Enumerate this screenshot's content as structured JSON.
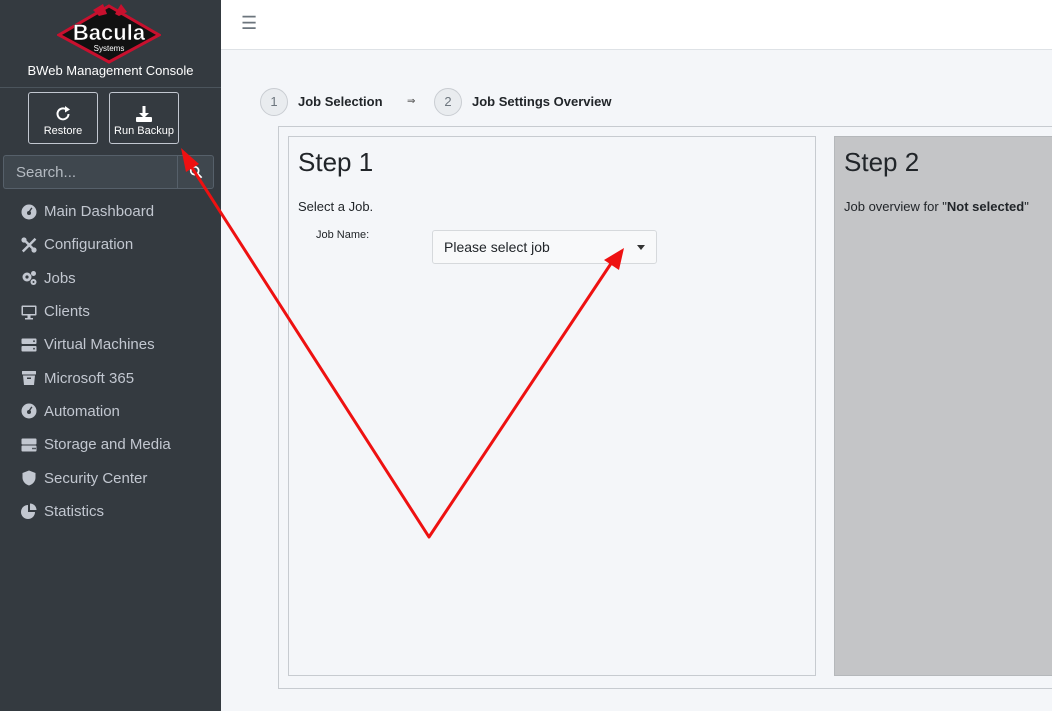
{
  "brand": {
    "logo_text": "Bacula",
    "logo_subtext": "Systems",
    "title": "BWeb Management Console"
  },
  "quick_actions": {
    "restore": "Restore",
    "run_backup": "Run Backup"
  },
  "search": {
    "placeholder": "Search..."
  },
  "nav": [
    {
      "label": "Main Dashboard",
      "icon": "dashboard-icon"
    },
    {
      "label": "Configuration",
      "icon": "tools-icon"
    },
    {
      "label": "Jobs",
      "icon": "cogs-icon"
    },
    {
      "label": "Clients",
      "icon": "desktop-icon"
    },
    {
      "label": "Virtual Machines",
      "icon": "server-icon"
    },
    {
      "label": "Microsoft 365",
      "icon": "trash-box-icon"
    },
    {
      "label": "Automation",
      "icon": "dashboard-icon"
    },
    {
      "label": "Storage and Media",
      "icon": "hdd-icon"
    },
    {
      "label": "Security Center",
      "icon": "shield-icon"
    },
    {
      "label": "Statistics",
      "icon": "pie-chart-icon"
    }
  ],
  "header": {
    "menu_icon": "☰"
  },
  "wizard": {
    "steps": [
      {
        "number": "1",
        "label": "Job Selection"
      },
      {
        "number": "2",
        "label": "Job Settings Overview"
      }
    ],
    "arrow": "⇒",
    "step1": {
      "title": "Step 1",
      "instruction": "Select a Job.",
      "job_name_label": "Job Name:",
      "job_select_value": "Please select job"
    },
    "step2": {
      "title": "Step 2",
      "overview_prefix": "Job overview for \"",
      "overview_value": "Not selected",
      "overview_suffix": "\""
    }
  },
  "colors": {
    "sidebar_bg": "#343a40",
    "annotation_arrow": "#ee1111",
    "step2_bg": "#c4c5c7"
  }
}
